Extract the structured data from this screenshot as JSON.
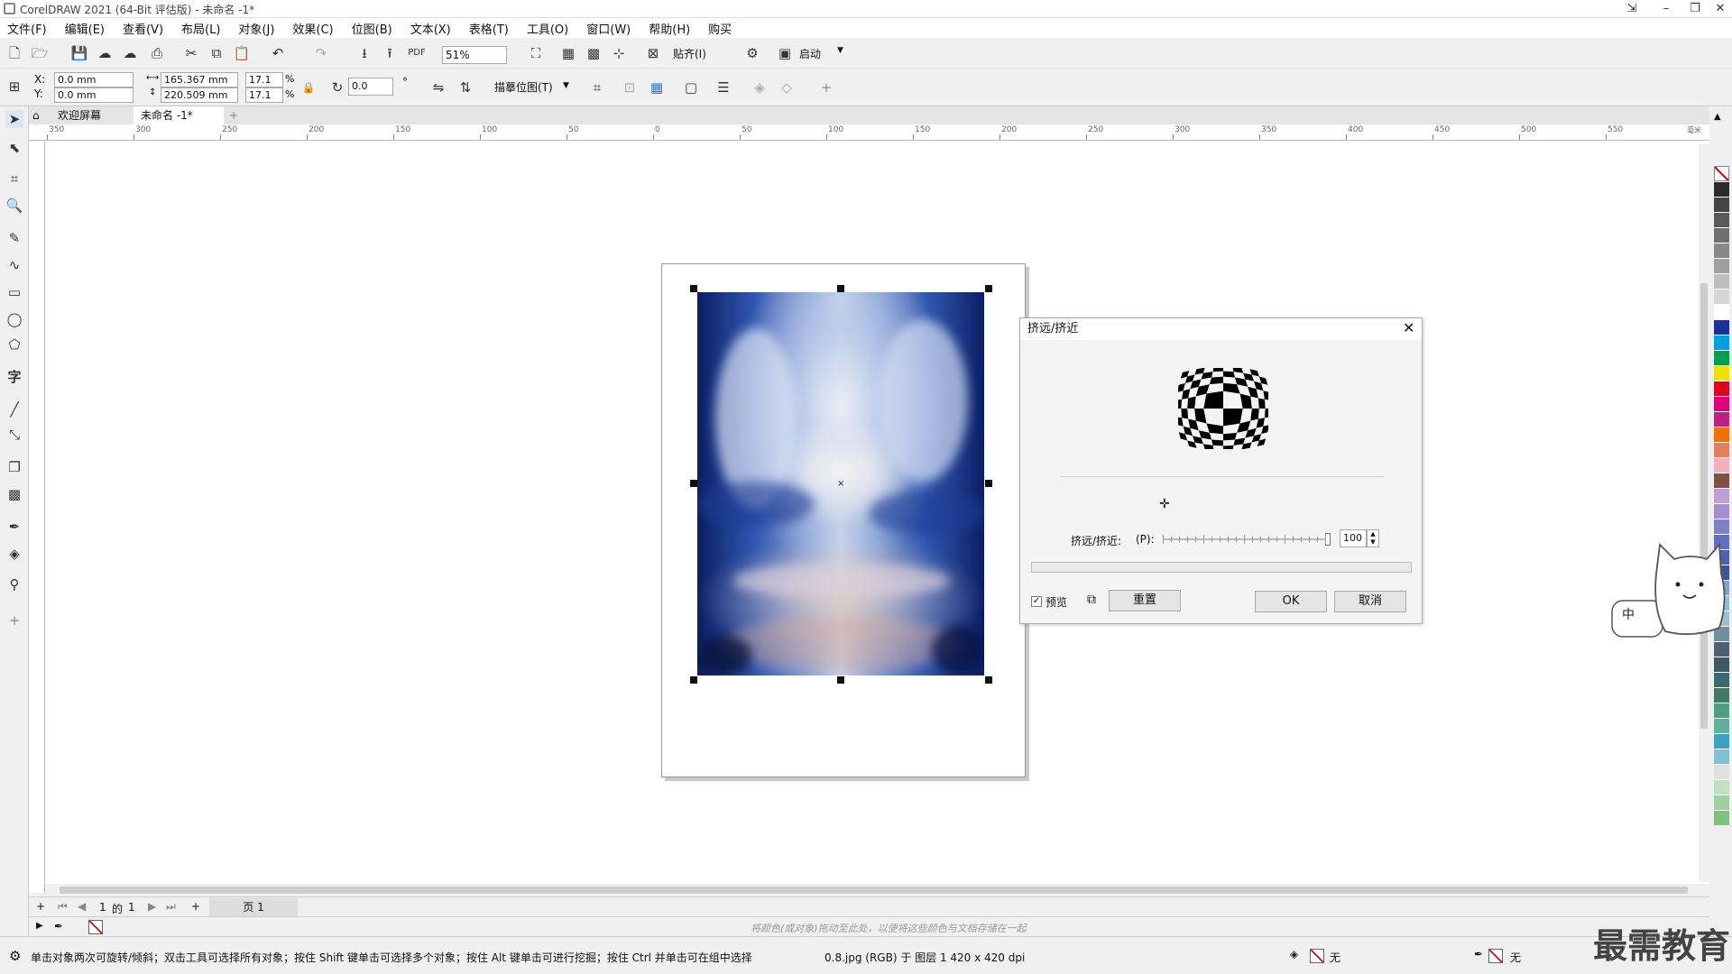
{
  "window": {
    "title": "CorelDRAW 2021 (64-Bit 评估版) - 未命名 -1*"
  },
  "menu": [
    "文件(F)",
    "编辑(E)",
    "查看(V)",
    "布局(L)",
    "对象(J)",
    "效果(C)",
    "位图(B)",
    "文本(X)",
    "表格(T)",
    "工具(O)",
    "窗口(W)",
    "帮助(H)",
    "购买"
  ],
  "toolbar": {
    "zoom": "51%",
    "snap_label": "贴齐(I)",
    "launch_label": "启动"
  },
  "props": {
    "x_label": "X:",
    "x_value": "0.0 mm",
    "y_label": "Y:",
    "y_value": "0.0 mm",
    "w_value": "165.367 mm",
    "h_value": "220.509 mm",
    "scale_w": "17.1",
    "scale_h": "17.1",
    "pct": "%",
    "angle": "0.0",
    "angle_unit": "°",
    "trace_label": "描摹位图(T)"
  },
  "tabs": {
    "welcome": "欢迎屏幕",
    "doc": "未命名 -1*"
  },
  "ruler": {
    "ticks": [
      "350",
      "300",
      "250",
      "200",
      "150",
      "100",
      "50",
      "0",
      "50",
      "100",
      "150",
      "200",
      "250",
      "300",
      "350",
      "400",
      "450",
      "500",
      "550"
    ],
    "unit": "毫米"
  },
  "pagenav": {
    "current": "1",
    "of": "的",
    "total": "1",
    "page_tab": "页 1"
  },
  "colorhint": "将颜色(或对象)拖动至此处，以便将这些颜色与文档存储在一起",
  "status": {
    "hint": "单击对象两次可旋转/倾斜；双击工具可选择所有对象；按住 Shift 键单击可选择多个对象；按住 Alt 键单击可进行挖掘；按住 Ctrl 并单击可在组中选择",
    "info": "0.8.jpg (RGB) 于 图层 1 420 x 420 dpi",
    "fill_none": "无",
    "outline_none": "无"
  },
  "dialog": {
    "title": "挤远/挤近",
    "slider_label": "挤远/挤近:",
    "slider_shortcut": "(P):",
    "value": "100",
    "slider_level": 1.0,
    "preview_label": "预览",
    "reset_label": "重置",
    "ok_label": "OK",
    "cancel_label": "取消"
  },
  "mascot_text": "中",
  "watermark": "最需教育",
  "palette": [
    "#2b2b2b",
    "#444444",
    "#5a5a5a",
    "#707070",
    "#888888",
    "#a0a0a0",
    "#bdbdbd",
    "#d6d6d6",
    "#ffffff",
    "#1a2fa0",
    "#00a0e0",
    "#00a050",
    "#f0e000",
    "#e00020",
    "#e0007a",
    "#c02080",
    "#f07000",
    "#e08060",
    "#f0b0c0",
    "#805040",
    "#c0a0d0",
    "#a090d0",
    "#8080c8",
    "#6070c0",
    "#5060b0",
    "#4050a0",
    "#80a0d0",
    "#90c0e0",
    "#a0c0d0",
    "#7090a0",
    "#506070",
    "#405860",
    "#3a6a70",
    "#407a60",
    "#50a080",
    "#60b0a0",
    "#40a0c0",
    "#80c0d0",
    "#e0e0e0",
    "#c0e0c0",
    "#a0d0a0",
    "#80c080"
  ]
}
